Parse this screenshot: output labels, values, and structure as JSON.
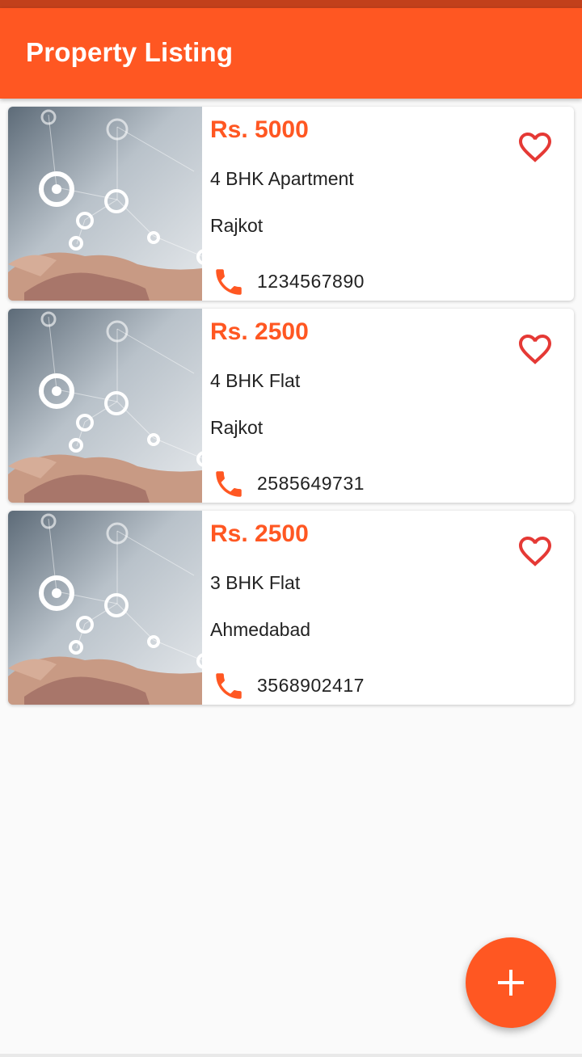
{
  "app_bar": {
    "title": "Property Listing"
  },
  "colors": {
    "primary": "#ff5722",
    "status_bar": "#c2401b",
    "favorite": "#e53935"
  },
  "listings": [
    {
      "price": "Rs. 5000",
      "title": "4 BHK Apartment",
      "city": "Rajkot",
      "phone": "1234567890",
      "image": "hand-network-image",
      "favorite_icon": "heart-outline-icon",
      "phone_icon": "phone-icon"
    },
    {
      "price": "Rs. 2500",
      "title": "4 BHK Flat",
      "city": "Rajkot",
      "phone": "2585649731",
      "image": "hand-network-image",
      "favorite_icon": "heart-outline-icon",
      "phone_icon": "phone-icon"
    },
    {
      "price": "Rs. 2500",
      "title": "3 BHK Flat",
      "city": "Ahmedabad",
      "phone": "3568902417",
      "image": "hand-network-image",
      "favorite_icon": "heart-outline-icon",
      "phone_icon": "phone-icon"
    }
  ],
  "fab": {
    "icon": "plus-icon"
  }
}
